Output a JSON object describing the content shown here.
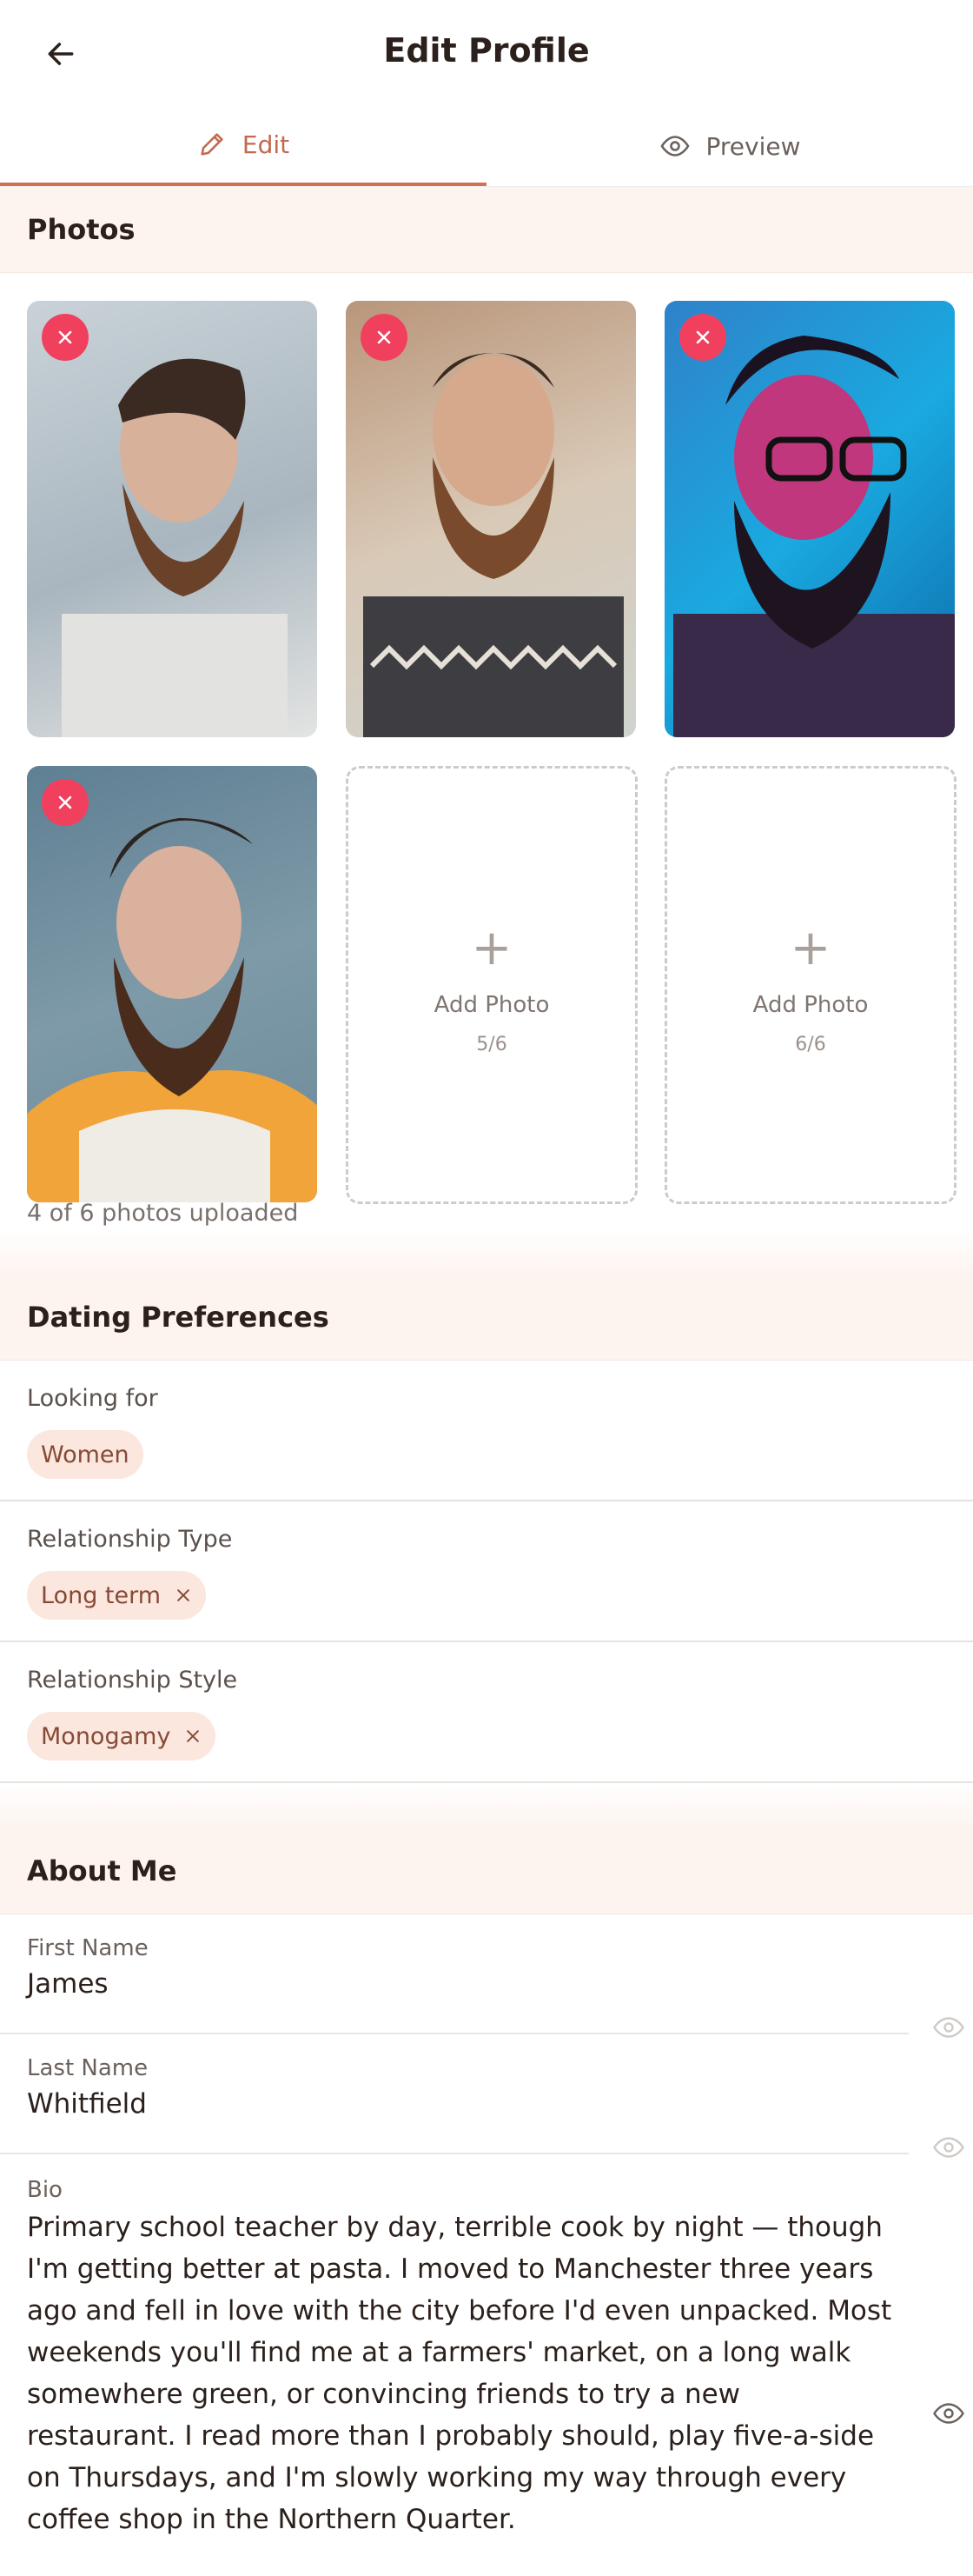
{
  "header": {
    "title": "Edit Profile"
  },
  "tabs": {
    "edit": "Edit",
    "preview": "Preview"
  },
  "photos": {
    "heading": "Photos",
    "add_label": "Add Photo",
    "slot5": "5/6",
    "slot6": "6/6",
    "uploaded": "4 of 6 photos uploaded"
  },
  "dating": {
    "heading": "Dating Preferences",
    "looking_for": {
      "label": "Looking for",
      "value": "Women"
    },
    "relationship_type": {
      "label": "Relationship Type",
      "value": "Long term"
    },
    "relationship_style": {
      "label": "Relationship Style",
      "value": "Monogamy"
    }
  },
  "about": {
    "heading": "About Me",
    "first_name": {
      "label": "First Name",
      "value": "James"
    },
    "last_name": {
      "label": "Last Name",
      "value": "Whitfield"
    },
    "bio": {
      "label": "Bio",
      "value": "Primary school teacher by day, terrible cook by night — though I'm getting better at pasta. I moved to Manchester three years ago and fell in love with the city before I'd even unpacked. Most weekends you'll find me at a farmers' market, on a long walk somewhere green, or convincing friends to try a new restaurant. I read more than I probably should, play five-a-side on Thursdays, and I'm slowly working my way through every coffee shop in the Northern Quarter."
    }
  },
  "colors": {
    "accent": "#d2704f",
    "remove": "#f0405e",
    "section_bg": "#fdf4ef",
    "chip_bg": "#fbe7de"
  }
}
